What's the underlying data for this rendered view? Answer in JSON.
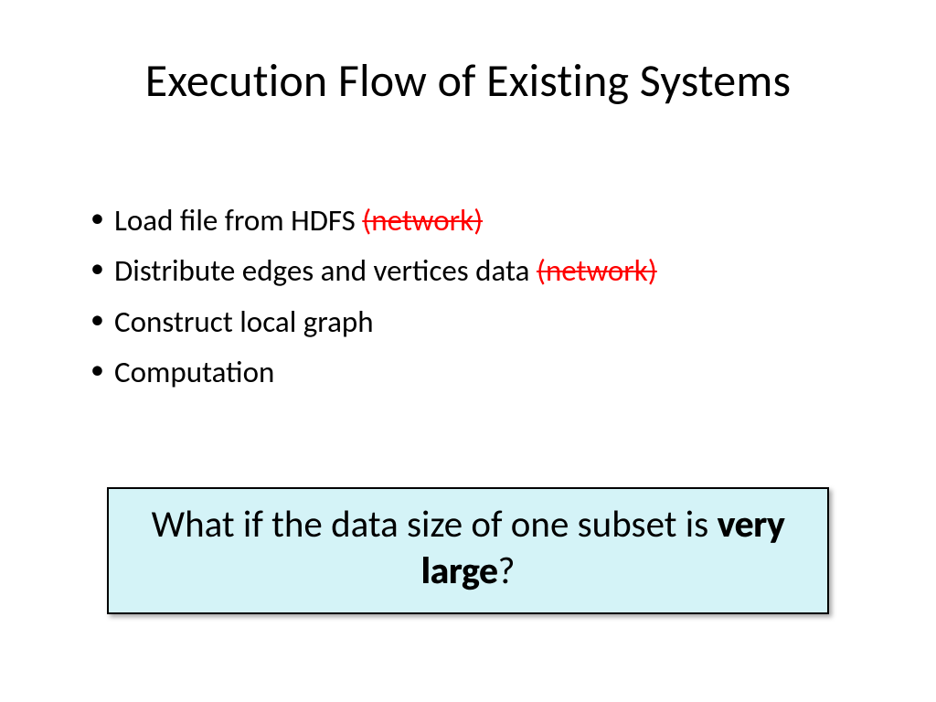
{
  "title": "Execution Flow of Existing Systems",
  "bullets": [
    {
      "text": "Load file from HDFS ",
      "annot": "(network)"
    },
    {
      "text": "Distribute edges and vertices data ",
      "annot": "(network)"
    },
    {
      "text": "Construct local graph",
      "annot": ""
    },
    {
      "text": "Computation",
      "annot": ""
    }
  ],
  "callout": {
    "lead": "What if the data size of one subset is ",
    "bold": "very large",
    "tail": "?"
  }
}
